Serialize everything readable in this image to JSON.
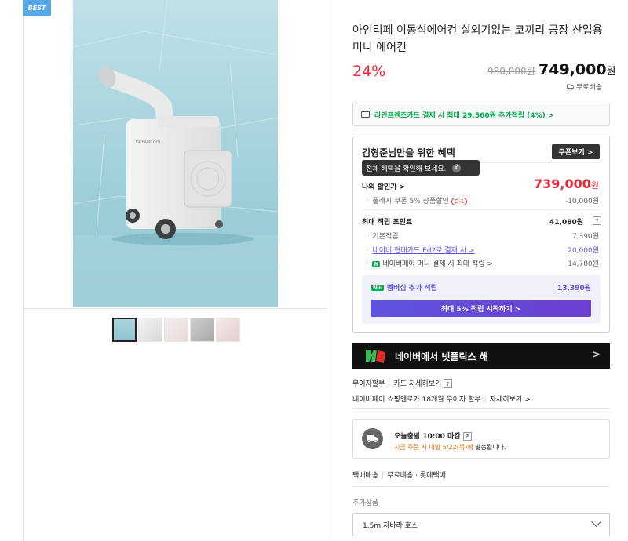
{
  "gallery": {
    "badge": "BEST",
    "product_brand_text": "DREAMCOOL",
    "thumbnails": [
      "thumb-1",
      "thumb-2",
      "thumb-3",
      "thumb-4",
      "thumb-5"
    ],
    "selected_thumbnail": 0
  },
  "product": {
    "title": "아인리페 이동식에어컨 실외기없는 코끼리 공장 산업용 미니 에어컨",
    "discount": "24%",
    "original_price": "980,000원",
    "price": "749,000",
    "price_unit": "원",
    "free_shipping": "무료배송"
  },
  "card_promo": {
    "text": "라인프렌즈카드 결제 시 최대 29,560원 추가적립 (4%) >"
  },
  "benefits": {
    "title": "김형준님만을 위한 혜택",
    "coupon_button": "쿠폰보기 >",
    "tooltip": "전체 혜택을 확인해 보세요.",
    "tooltip_close": "X",
    "my_price_label": "나의 할인가 >",
    "my_price": "739,000",
    "my_price_unit": "원",
    "coupon_row": {
      "label": "플래시 쿠폰 5% 상품할인",
      "badge": "D-1",
      "value": "-10,000원"
    },
    "points_label": "최대 적립 포인트",
    "points_value": "41,080원",
    "points_help": "?",
    "points_rows": [
      {
        "label": "기본적립",
        "value": "7,390원"
      },
      {
        "label": "네이버 현대카드 Ed2로 결제 시 >",
        "value": "20,000원"
      },
      {
        "label": "네이버페이 머니 결제 시 최대 적립 >",
        "value": "14,780원"
      }
    ],
    "member_label": "멤버십 추가 적립",
    "member_badge": "N+",
    "member_value": "13,390원",
    "start_button": "최대 5% 적립 시작하기 >"
  },
  "banner": {
    "text": "네이버에서 넷플릭스 해",
    "chevron": ">"
  },
  "installment": {
    "row1_a": "무이자할부",
    "row1_b": "카드 자세히보기",
    "row1_help": "?",
    "row2_a": "네이버페이 쇼핑엔로카 18개월 무이자 할부",
    "row2_b": "자세히보기 >"
  },
  "delivery": {
    "title": "오늘출발 10:00 마감",
    "help": "?",
    "sub_orange": "지금 주문 시 내일 5/22(목)에",
    "sub_rest": " 발송됩니다."
  },
  "shipping_info": {
    "a": "택배배송",
    "b": "무료배송 · 롯데택배"
  },
  "addon": {
    "label": "추가상품",
    "selected": "1.5m 자바라 호스"
  }
}
